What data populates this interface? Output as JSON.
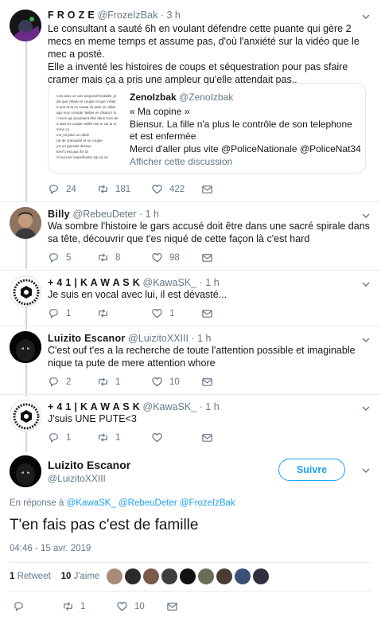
{
  "tweets": [
    {
      "name": "F R O Z E",
      "handle": "@FrozeIzBak",
      "dot": "·",
      "time": "3 h",
      "text": "Le consultant a sauté 6h en voulant défendre cette puante qui gère 2 mecs en meme temps et assume pas, d'où l'anxiété sur la vidéo que le mec a posté.\nElle a inventé les histoires de coups et séquestration pour pas sfaire cramer mais ça a pris une ampleur qu'elle attendait pas..",
      "replies": "24",
      "retweets": "181",
      "likes": "422",
      "quote": {
        "name": "ZenoIzbak",
        "handle": "@ZenoIzbak",
        "text": "« Ma copine »\nBiensur. La fille n'a plus le contrôle de son telephone et est enfermée\nMerci d'aller plus vite @PoliceNationale @PoliceNat34",
        "link": "Afficher cette discussion",
        "image_lines": [
          "vois avec un ami oiepseolf instable, je",
          "dis que j'étais en couple et que c'était",
          "ir une et la ce soutar ils pete un câble",
          "ago mon compte 'twitter en disant il m",
          "i mecs qui pousaient être dans mon de",
          "a sais en couple vaiille mai m vai ai m",
          "mme ca",
          "me j'ai pete un câble",
          "j'ai de cracquiéé et se couple",
          "y'a un guerale dessus",
          "brief c'est pas ihn lâ",
          "nt aucune inquiettudes typ ça va"
        ]
      }
    },
    {
      "name": "Billy",
      "handle": "@RebeuDeter",
      "dot": "·",
      "time": "1 h",
      "text": "Wa sombre l'histoire le gars accusé doit être dans une sacré spirale dans sa tête, découvrir que t'es niqué de cette façon là c'est hard",
      "replies": "5",
      "retweets": "8",
      "likes": "98"
    },
    {
      "name": "+ 4 1 | K A W A S K",
      "handle": "@KawaSK_",
      "dot": "·",
      "time": "1 h",
      "text": "Je suis en vocal avec lui, il est dévasté...",
      "replies": "1",
      "retweets": "",
      "likes": "1"
    },
    {
      "name": "Luizito Escanor",
      "handle": "@LuizitoXXIII",
      "dot": "·",
      "time": "1 h",
      "text": "C'est ouf t'es a la recherche de toute l'attention possible et imaginable nique ta pute de mere attention whore",
      "replies": "2",
      "retweets": "1",
      "likes": "10"
    },
    {
      "name": "+ 4 1 | K A W A S K",
      "handle": "@KawaSK_",
      "dot": "·",
      "time": "1 h",
      "text": "J'suis UNE PUTE<3",
      "replies": "1",
      "retweets": "1",
      "likes": ""
    }
  ],
  "main": {
    "name": "Luizito Escanor",
    "handle": "@LuizitoXXIII",
    "follow_label": "Suivre",
    "reply_prefix": "En réponse à",
    "reply_mentions": "@KawaSK_ @RebeuDeter @FrozeIzBak",
    "text": "T'en fais pas c'est de famille",
    "timestamp": "04:46 - 15 avr. 2019",
    "retweet_count": "1",
    "retweet_label": "Retweet",
    "like_count": "10",
    "like_label": "J'aime",
    "actions": {
      "replies": "",
      "retweets": "1",
      "likes": "10"
    }
  },
  "colors": {
    "accent": "#1da1f2",
    "muted": "#657786",
    "like_red": "#e0245e",
    "border": "#e6ecf0"
  }
}
